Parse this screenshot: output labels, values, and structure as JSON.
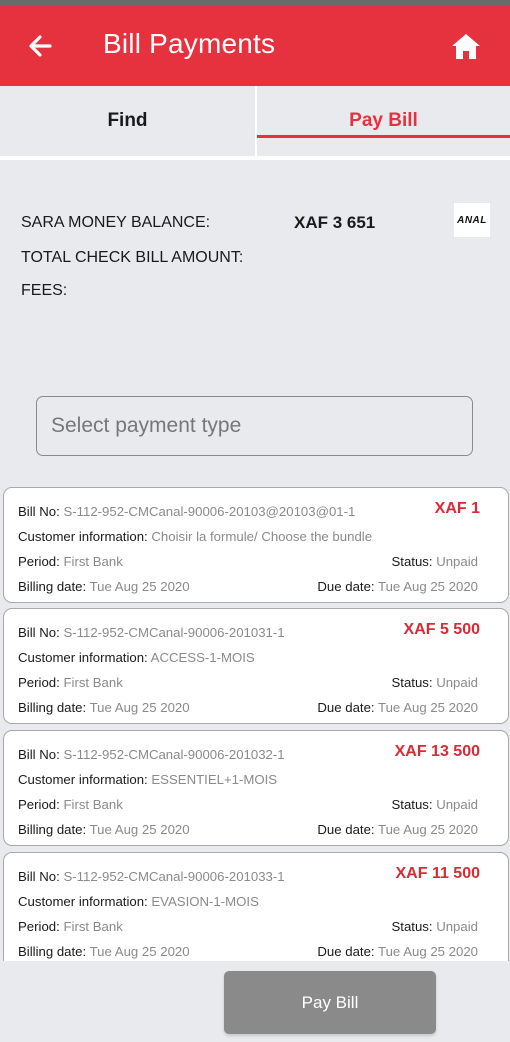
{
  "appbar": {
    "title": "Bill Payments"
  },
  "tabs": {
    "find": "Find",
    "pay_bill": "Pay Bill"
  },
  "summary": {
    "balance_label": "SARA MONEY BALANCE:",
    "balance_value": "XAF 3 651",
    "total_label": "TOTAL CHECK BILL AMOUNT:",
    "fees_label": "FEES:",
    "logo_text": "ANAL"
  },
  "payment_type": {
    "placeholder": "Select payment type"
  },
  "labels": {
    "bill_no": "Bill No: ",
    "customer": "Customer information: ",
    "period": "Period: ",
    "status": "Status: ",
    "billing_date": "Billing date: ",
    "due_date": "Due date: "
  },
  "bills": [
    {
      "bill_no": "S-112-952-CMCanal-90006-20103@20103@01-1",
      "amount": "XAF 1",
      "customer": "Choisir la formule/ Choose the bundle",
      "period": "First Bank",
      "status": "Unpaid",
      "billing_date": "Tue Aug 25 2020",
      "due_date": "Tue Aug 25 2020"
    },
    {
      "bill_no": "S-112-952-CMCanal-90006-201031-1",
      "amount": "XAF 5 500",
      "customer": "ACCESS-1-MOIS",
      "period": "First Bank",
      "status": "Unpaid",
      "billing_date": "Tue Aug 25 2020",
      "due_date": "Tue Aug 25 2020"
    },
    {
      "bill_no": "S-112-952-CMCanal-90006-201032-1",
      "amount": "XAF 13 500",
      "customer": "ESSENTIEL+1-MOIS",
      "period": "First Bank",
      "status": "Unpaid",
      "billing_date": "Tue Aug 25 2020",
      "due_date": "Tue Aug 25 2020"
    },
    {
      "bill_no": "S-112-952-CMCanal-90006-201033-1",
      "amount": "XAF 11 500",
      "customer": "EVASION-1-MOIS",
      "period": "First Bank",
      "status": "Unpaid",
      "billing_date": "Tue Aug 25 2020",
      "due_date": "Tue Aug 25 2020"
    }
  ],
  "footer": {
    "pay_button": "Pay Bill"
  },
  "colors": {
    "accent": "#e6313f",
    "amount": "#d92a36",
    "button_disabled": "#8a8a8a"
  }
}
